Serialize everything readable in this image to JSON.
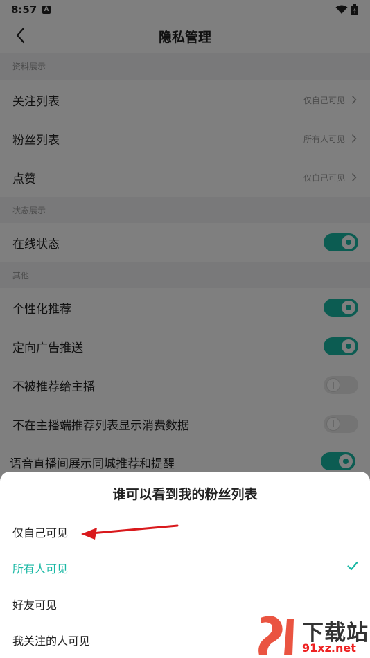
{
  "status_bar": {
    "time": "8:57",
    "notification_badge": "A"
  },
  "header": {
    "title": "隐私管理"
  },
  "sections": [
    {
      "title": "资料展示"
    },
    {
      "title": "状态展示"
    },
    {
      "title": "其他"
    }
  ],
  "profile_rows": [
    {
      "label": "关注列表",
      "value": "仅自己可见"
    },
    {
      "label": "粉丝列表",
      "value": "所有人可见"
    },
    {
      "label": "点赞",
      "value": "仅自己可见"
    }
  ],
  "status_rows": [
    {
      "label": "在线状态",
      "enabled": true
    }
  ],
  "other_rows": [
    {
      "label": "个性化推荐",
      "enabled": true
    },
    {
      "label": "定向广告推送",
      "enabled": true
    },
    {
      "label": "不被推荐给主播",
      "enabled": false
    },
    {
      "label": "不在主播端推荐列表显示消费数据",
      "enabled": false
    },
    {
      "label": "语音直播间展示同城推荐和提醒",
      "enabled": true
    }
  ],
  "sheet": {
    "title": "谁可以看到我的粉丝列表",
    "options": [
      {
        "label": "仅自己可见",
        "selected": false
      },
      {
        "label": "所有人可见",
        "selected": true
      },
      {
        "label": "好友可见",
        "selected": false
      },
      {
        "label": "我关注的人可见",
        "selected": false
      }
    ]
  },
  "watermark": {
    "title": "下载站",
    "url": "91xz.net"
  },
  "colors": {
    "accent": "#19b8a4",
    "annotation_arrow": "#d9191c",
    "overlay": "rgba(0,0,0,0.5)"
  }
}
